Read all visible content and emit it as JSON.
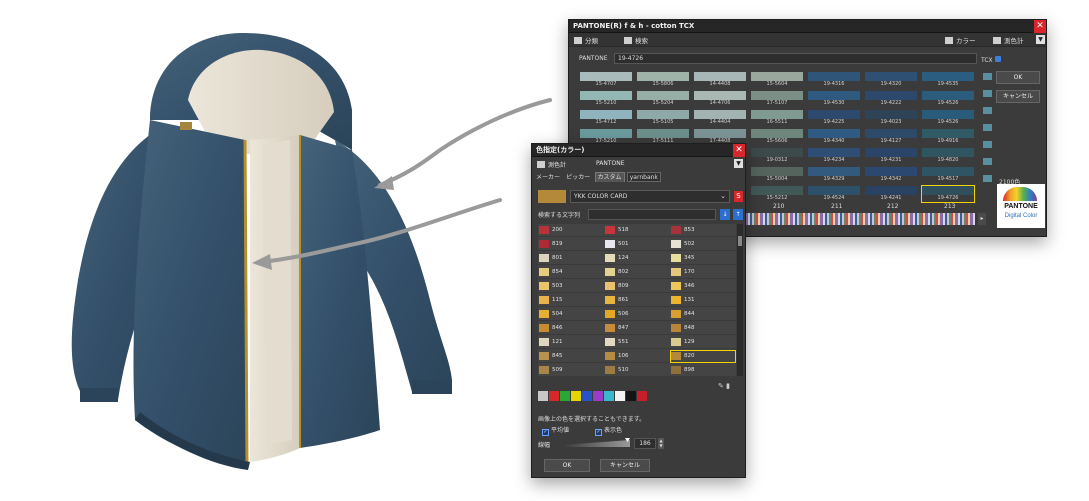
{
  "pantone_window": {
    "title": "PANTONE(R) f & h - cotton TCX",
    "toolbar": {
      "classify": "分類",
      "search": "検索",
      "color": "カラー",
      "meter": "測色計"
    },
    "code_label": "PANTONE",
    "code_value": "19-4726",
    "code_suffix": "TCX",
    "swatches": [
      {
        "code": "15-4707",
        "color": "#a9bbbb"
      },
      {
        "code": "15-5806",
        "color": "#9fb3a9"
      },
      {
        "code": "14-4408",
        "color": "#a7b6b6"
      },
      {
        "code": "15-5604",
        "color": "#9aa79c"
      },
      {
        "code": "19-4316",
        "color": "#2f5678"
      },
      {
        "code": "19-4320",
        "color": "#2e5173"
      },
      {
        "code": "19-4535",
        "color": "#2a5d80"
      },
      {
        "code": "15-5210",
        "color": "#93b7b2"
      },
      {
        "code": "15-5204",
        "color": "#97aea6"
      },
      {
        "code": "14-4706",
        "color": "#aab8b3"
      },
      {
        "code": "17-5107",
        "color": "#7c8f86"
      },
      {
        "code": "19-4530",
        "color": "#2f5a80"
      },
      {
        "code": "19-4222",
        "color": "#2c496b"
      },
      {
        "code": "19-4526",
        "color": "#2c5c7c"
      },
      {
        "code": "15-4712",
        "color": "#8fb4bd"
      },
      {
        "code": "15-5105",
        "color": "#8eaaa8"
      },
      {
        "code": "14-4404",
        "color": "#a3b3b2"
      },
      {
        "code": "16-5511",
        "color": "#7f9a90"
      },
      {
        "code": "19-4225",
        "color": "#2d4a6e"
      },
      {
        "code": "19-4023",
        "color": "#2e4258"
      },
      {
        "code": "19-4526",
        "color": "#2b5b7a"
      },
      {
        "code": "17-5210",
        "color": "#6a9a9c"
      },
      {
        "code": "17-5111",
        "color": "#6c8f8c"
      },
      {
        "code": "17-4408",
        "color": "#7c9396"
      },
      {
        "code": "15-5606",
        "color": "#6f867c"
      },
      {
        "code": "19-4340",
        "color": "#2f5b83"
      },
      {
        "code": "19-4127",
        "color": "#2d4a68"
      },
      {
        "code": "19-4916",
        "color": "#305a66"
      },
      {
        "code": "",
        "color": "#4c7a7c"
      },
      {
        "code": "",
        "color": "#4d6f6d"
      },
      {
        "code": "",
        "color": "#5a7377"
      },
      {
        "code": "19-0312",
        "color": "#3c4a4c"
      },
      {
        "code": "19-4234",
        "color": "#2f4e76"
      },
      {
        "code": "19-4231",
        "color": "#2b4568"
      },
      {
        "code": "19-4820",
        "color": "#2e5560"
      },
      {
        "code": "",
        "color": "#3c6063"
      },
      {
        "code": "",
        "color": "#3e5a5a"
      },
      {
        "code": "",
        "color": "#45595c"
      },
      {
        "code": "15-5004",
        "color": "#56645e"
      },
      {
        "code": "19-4329",
        "color": "#325a7e"
      },
      {
        "code": "19-4342",
        "color": "#2b4870"
      },
      {
        "code": "19-4517",
        "color": "#2f5564"
      },
      {
        "code": "",
        "color": "#2f4c4f"
      },
      {
        "code": "",
        "color": "#33484a"
      },
      {
        "code": "",
        "color": "#39484c"
      },
      {
        "code": "15-5212",
        "color": "#405856"
      },
      {
        "code": "19-4524",
        "color": "#2d506b"
      },
      {
        "code": "19-4241",
        "color": "#2a4261"
      },
      {
        "code": "19-4726",
        "color": "#2e4f5b"
      }
    ],
    "selected_code": "19-4726",
    "buttons": {
      "ok": "OK",
      "cancel": "キャンセル"
    },
    "count": "2100色",
    "logo_text": "PANTONE",
    "logo_sub": "Digital Color",
    "index_labels": [
      "210",
      "211",
      "212",
      "213"
    ]
  },
  "color_window": {
    "title": "色指定(カラー)",
    "meter": "測色計",
    "brand": "PANTONE",
    "tabs": [
      "メーカー",
      "ピッカー",
      "カスタム",
      "yarnbank"
    ],
    "card_value": "YKK COLOR CARD",
    "card_color": "#b48a3a",
    "search_label": "検索する文字列",
    "colors": [
      {
        "name": "200",
        "color": "#b8323a"
      },
      {
        "name": "518",
        "color": "#c8343d"
      },
      {
        "name": "853",
        "color": "#a8323a"
      },
      {
        "name": "819",
        "color": "#b02a35"
      },
      {
        "name": "501",
        "color": "#e8e7ef"
      },
      {
        "name": "502",
        "color": "#e8e3d2"
      },
      {
        "name": "801",
        "color": "#dcd4bf"
      },
      {
        "name": "124",
        "color": "#e4dbb9"
      },
      {
        "name": "345",
        "color": "#e8dd9a"
      },
      {
        "name": "854",
        "color": "#e6cc7e"
      },
      {
        "name": "802",
        "color": "#e3d390"
      },
      {
        "name": "170",
        "color": "#e7c77c"
      },
      {
        "name": "503",
        "color": "#e9c46a"
      },
      {
        "name": "809",
        "color": "#e9c26b"
      },
      {
        "name": "346",
        "color": "#efc658"
      },
      {
        "name": "115",
        "color": "#e8b34a"
      },
      {
        "name": "861",
        "color": "#e9b63d"
      },
      {
        "name": "131",
        "color": "#ecb52d"
      },
      {
        "name": "504",
        "color": "#e4b133"
      },
      {
        "name": "506",
        "color": "#e4a829"
      },
      {
        "name": "844",
        "color": "#d89e31"
      },
      {
        "name": "846",
        "color": "#c98c2d"
      },
      {
        "name": "847",
        "color": "#c88a3b"
      },
      {
        "name": "848",
        "color": "#b8843c"
      },
      {
        "name": "121",
        "color": "#ddd6c0"
      },
      {
        "name": "551",
        "color": "#e1d9c2"
      },
      {
        "name": "129",
        "color": "#d9c990"
      },
      {
        "name": "845",
        "color": "#b6934e"
      },
      {
        "name": "106",
        "color": "#b48c44"
      },
      {
        "name": "820",
        "color": "#b48a3a"
      },
      {
        "name": "509",
        "color": "#a8864a"
      },
      {
        "name": "510",
        "color": "#9d7b42"
      },
      {
        "name": "898",
        "color": "#8f6f3a"
      }
    ],
    "selected_color": "820",
    "palette": [
      "#c8c8c8",
      "#d62828",
      "#2aa836",
      "#e8d400",
      "#2852c8",
      "#9b3cc8",
      "#38b8c8",
      "#f2f2f2",
      "#141414",
      "#c61f2b"
    ],
    "hint": "画像上の色を選択することもできます。",
    "check_average": "平均値",
    "check_display": "表示色",
    "width_label": "線幅",
    "width_value": "186",
    "buttons": {
      "ok": "OK",
      "cancel": "キャンセル"
    }
  }
}
